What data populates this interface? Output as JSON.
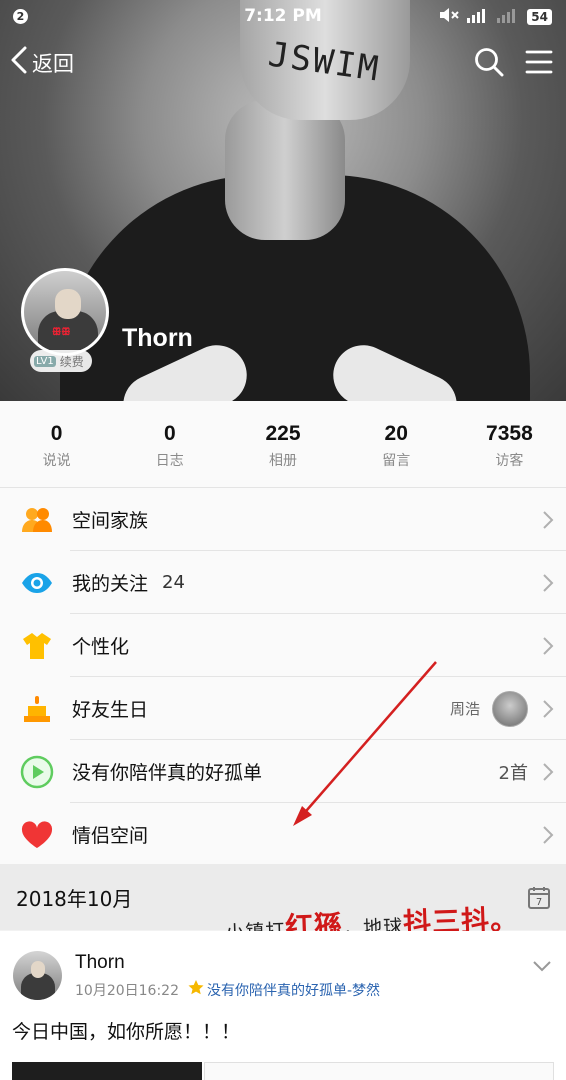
{
  "status_bar": {
    "notif_count": "2",
    "time": "7:12 PM",
    "battery": "54"
  },
  "nav": {
    "back_label": "返回"
  },
  "profile": {
    "name": "Thorn",
    "level": "LV1",
    "renew_label": "续费"
  },
  "stats": [
    {
      "value": "0",
      "label": "说说"
    },
    {
      "value": "0",
      "label": "日志"
    },
    {
      "value": "225",
      "label": "相册"
    },
    {
      "value": "20",
      "label": "留言"
    },
    {
      "value": "7358",
      "label": "访客"
    }
  ],
  "menu": [
    {
      "icon": "family-icon",
      "title": "空间家族"
    },
    {
      "icon": "eye-icon",
      "title": "我的关注",
      "count": "24"
    },
    {
      "icon": "tshirt-icon",
      "title": "个性化"
    },
    {
      "icon": "cake-icon",
      "title": "好友生日",
      "right": "周浩"
    },
    {
      "icon": "play-icon",
      "title": "没有你陪伴真的好孤单",
      "right": "2首"
    },
    {
      "icon": "heart-icon",
      "title": "情侣空间"
    }
  ],
  "date_section": {
    "date": "2018年10月",
    "calendar_day": "7",
    "calligraphy_a": "小镇打",
    "calligraphy_b": "红猻",
    "calligraphy_c": "，地球",
    "calligraphy_d": "抖三抖",
    "calligraphy_e": "。"
  },
  "post": {
    "author": "Thorn",
    "datetime": "10月20日16:22",
    "music": "没有你陪伴真的好孤单-梦然",
    "text": "今日中国，如你所愿！！！"
  },
  "colors": {
    "accent_blue": "#2b64b0",
    "annotation_arrow": "#d42020"
  }
}
